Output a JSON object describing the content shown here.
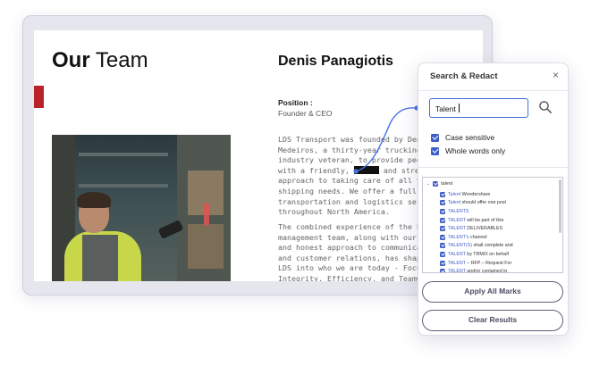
{
  "document": {
    "heading_bold": "Our",
    "heading_light": "Team",
    "person_name": "Denis Panagiotis",
    "position_label": "Position   :",
    "position_value": "Founder & CEO",
    "paragraph1_line1": "LDS Transport was founded by Denis",
    "paragraph1_line2": "Medeiros, a thirty-year trucking",
    "paragraph1_line3": "industry veteran, to provide people",
    "paragraph1_line4_before": "with a friendly, ",
    "paragraph1_line4_after": " and streamlined",
    "paragraph1_line5": "approach to taking care of all your",
    "paragraph1_line6": "shipping needs. We offer a full suite of",
    "paragraph1_line7": "transportation and logistics services",
    "paragraph1_line8": "throughout North America.",
    "paragraph2_line1": "The combined experience of the LDS",
    "paragraph2_line2": "management team, along with our open",
    "paragraph2_line3": "and honest approach to communication",
    "paragraph2_line4": "and customer relations, has shaped",
    "paragraph2_line5": "LDS into who we are today - Focused on",
    "paragraph2_line6": "Integrity, Efficiency, and Teamwork."
  },
  "panel": {
    "title": "Search & Redact",
    "close_glyph": "×",
    "search_value": "Talent",
    "options": [
      {
        "label": "Case sensitive",
        "checked": true
      },
      {
        "label": "Whole words only",
        "checked": true
      }
    ],
    "results_root": "talent",
    "results": [
      {
        "match": "Talent",
        "rest": " Wondershare"
      },
      {
        "match": "Talent",
        "rest": " should offer one post"
      },
      {
        "match": "TALENTS",
        "rest": ""
      },
      {
        "match": "TALENT",
        "rest": " will be part of this"
      },
      {
        "match": "TALENT",
        "rest": " DELIVERABLES"
      },
      {
        "match": "TALENT's",
        "rest": " channel"
      },
      {
        "match": "TALENT(S)",
        "rest": " shall complete and"
      },
      {
        "match": "TALENT",
        "rest": " by TRMIX on behalf"
      },
      {
        "match": "TALENT",
        "rest": " – RFP – Request For"
      },
      {
        "match": "TALENT",
        "rest": " and/or contained in"
      }
    ],
    "apply_label": "Apply All Marks",
    "clear_label": "Clear Results"
  },
  "colors": {
    "accent_blue": "#3d5fc7",
    "brand_red": "#b8232a",
    "redaction_black": "#111111"
  },
  "icons": [
    "search-icon",
    "close-icon",
    "checkbox-checked-icon",
    "collapse-arrow-icon"
  ]
}
